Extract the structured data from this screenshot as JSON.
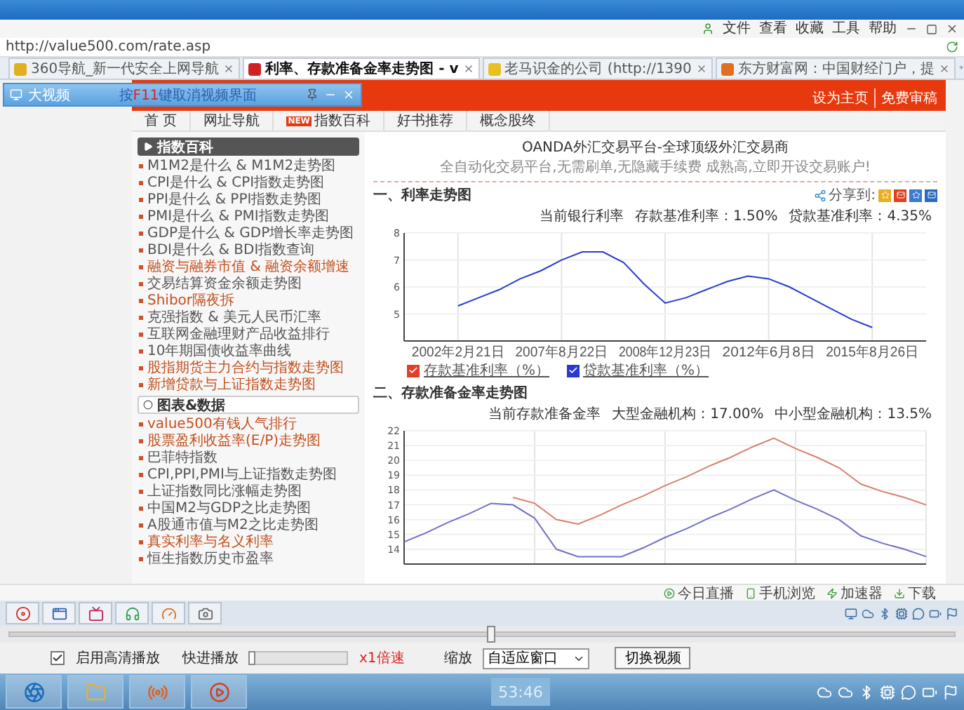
{
  "menu": [
    "文件",
    "查看",
    "收藏",
    "工具",
    "帮助"
  ],
  "address": "http://value500.com/rate.asp",
  "tabs": [
    {
      "label": "360导航_新一代安全上网导航",
      "selected": false
    },
    {
      "label": "利率、存款准备金率走势图 - v",
      "selected": true
    },
    {
      "label": "老马识金的公司 (http://1390",
      "selected": false
    },
    {
      "label": "东方财富网：中国财经门户，提",
      "selected": false
    }
  ],
  "floating_window": {
    "title": "大视频",
    "hint_before": "按",
    "hint_key": "F11",
    "hint_after": "键取消视频界面"
  },
  "site": {
    "top_links": [
      "设为主页",
      "免费审稿"
    ],
    "nav": [
      {
        "label": "首 页"
      },
      {
        "label": "网址导航"
      },
      {
        "label": "指数百科",
        "badge": "NEW"
      },
      {
        "label": "好书推荐"
      },
      {
        "label": "概念股终"
      }
    ],
    "sidebar": [
      {
        "kind": "dark",
        "title": "指数百科",
        "items": [
          {
            "label": "M1M2是什么 & M1M2走势图",
            "highlight": false
          },
          {
            "label": "CPI是什么 & CPI指数走势图",
            "highlight": false
          },
          {
            "label": "PPI是什么 & PPI指数走势图",
            "highlight": false
          },
          {
            "label": "PMI是什么 & PMI指数走势图",
            "highlight": false
          },
          {
            "label": "GDP是什么 & GDP增长率走势图",
            "highlight": false
          },
          {
            "label": "BDI是什么 & BDI指数查询",
            "highlight": false
          },
          {
            "label": "融资与融券市值 & 融资余额增速",
            "highlight": true
          },
          {
            "label": "交易结算资金余额走势图",
            "highlight": false
          },
          {
            "label": "Shibor隔夜拆",
            "highlight": true
          },
          {
            "label": "克强指数 & 美元人民币汇率",
            "highlight": false
          },
          {
            "label": "互联网金融理财产品收益排行",
            "highlight": false
          },
          {
            "label": "10年期国债收益率曲线",
            "highlight": false
          },
          {
            "label": "股指期货主力合约与指数走势图",
            "highlight": true
          },
          {
            "label": "新增贷款与上证指数走势图",
            "highlight": true
          }
        ]
      },
      {
        "kind": "light",
        "title": "图表&数据",
        "items": [
          {
            "label": "value500有钱人气排行",
            "highlight": true
          },
          {
            "label": "股票盈利收益率(E/P)走势图",
            "highlight": true
          },
          {
            "label": "巴菲特指数",
            "highlight": false
          },
          {
            "label": "CPI,PPI,PMI与上证指数走势图",
            "highlight": false
          },
          {
            "label": "上证指数同比涨幅走势图",
            "highlight": false
          },
          {
            "label": "中国M2与GDP之比走势图",
            "highlight": false
          },
          {
            "label": "A股通市值与M2之比走势图",
            "highlight": false
          },
          {
            "label": "真实利率与名义利率",
            "highlight": true
          },
          {
            "label": "恒生指数历史市盈率",
            "highlight": false
          }
        ]
      }
    ],
    "ad": {
      "title": "OANDA外汇交易平台-全球顶级外汇交易商",
      "text": "全自动化交易平台,无需刷单,无隐藏手续费 成熟高,立即开设交易账户!"
    },
    "sections": [
      {
        "title": "一、利率走势图",
        "share": "分享到:",
        "summary": [
          "当前银行利率",
          "存款基准利率：1.50%",
          "贷款基准利率：4.35%"
        ],
        "legend": [
          {
            "checked": true
          },
          {
            "checked": true
          }
        ],
        "chart_data": {
          "type": "line",
          "categories": [
            "2002年2月21日",
            null,
            null,
            null,
            null,
            "2007年8月22日",
            null,
            null,
            null,
            null,
            "2008年12月23日",
            null,
            null,
            null,
            null,
            "2012年6月8日",
            null,
            null,
            null,
            null,
            "2015年8月26日"
          ],
          "grid": true,
          "ylim": [
            4,
            8
          ],
          "yticks": [
            5,
            6,
            7,
            8
          ],
          "series": [
            {
              "name": "存款基准利率（%）",
              "color": "#e0402a",
              "values": [
                null,
                null,
                null,
                null,
                null,
                null,
                null,
                null,
                null,
                null,
                null,
                null,
                null,
                null,
                null,
                null,
                null,
                null,
                null,
                null,
                null
              ]
            },
            {
              "name": "贷款基准利率（%）",
              "color": "#2a3ad0",
              "values": [
                5.3,
                5.6,
                5.9,
                6.3,
                6.6,
                7.0,
                7.3,
                7.3,
                6.9,
                6.1,
                5.4,
                5.6,
                5.9,
                6.2,
                6.4,
                6.3,
                6.0,
                5.6,
                5.2,
                4.8,
                4.5
              ]
            }
          ]
        }
      },
      {
        "title": "二、存款准备金率走势图",
        "summary": [
          "当前存款准备金率",
          "大型金融机构：17.00%",
          "中小型金融机构：13.5%"
        ],
        "chart_data": {
          "type": "line",
          "categories": [
            null,
            null,
            null,
            null,
            null,
            null,
            null,
            null,
            null,
            null,
            null,
            null,
            null,
            null,
            null,
            null,
            null,
            null,
            null,
            null,
            null,
            null,
            null,
            null,
            null
          ],
          "grid": true,
          "ylim": [
            13,
            22
          ],
          "yticks": [
            14,
            15,
            16,
            17,
            18,
            19,
            20,
            21,
            22
          ],
          "series": [
            {
              "color": "#d88070",
              "values": [
                null,
                null,
                null,
                null,
                null,
                17.5,
                17.1,
                16.0,
                15.7,
                16.3,
                17.0,
                17.6,
                18.3,
                18.9,
                19.6,
                20.2,
                20.9,
                21.5,
                20.8,
                20.2,
                19.5,
                18.4,
                17.9,
                17.5,
                17.0
              ]
            },
            {
              "color": "#7070c8",
              "values": [
                14.5,
                15.1,
                15.8,
                16.4,
                17.1,
                17.0,
                16.1,
                14.0,
                13.5,
                13.5,
                13.5,
                14.1,
                14.8,
                15.4,
                16.1,
                16.7,
                17.4,
                18.0,
                17.3,
                16.7,
                16.0,
                14.9,
                14.4,
                14.0,
                13.5
              ]
            }
          ]
        }
      }
    ]
  },
  "status_bar": [
    "今日直播",
    "手机浏览",
    "加速器",
    "下载"
  ],
  "player": {
    "seek": {
      "level": 0.51
    },
    "hd": {
      "label": "启用高清播放",
      "checked": true
    },
    "fast": {
      "label": "快进播放",
      "level": 0,
      "speed": "x1倍速"
    },
    "zoom": {
      "label": "缩放",
      "value": "自适应窗口"
    },
    "switch_button": "切换视频",
    "time": "53:46"
  }
}
